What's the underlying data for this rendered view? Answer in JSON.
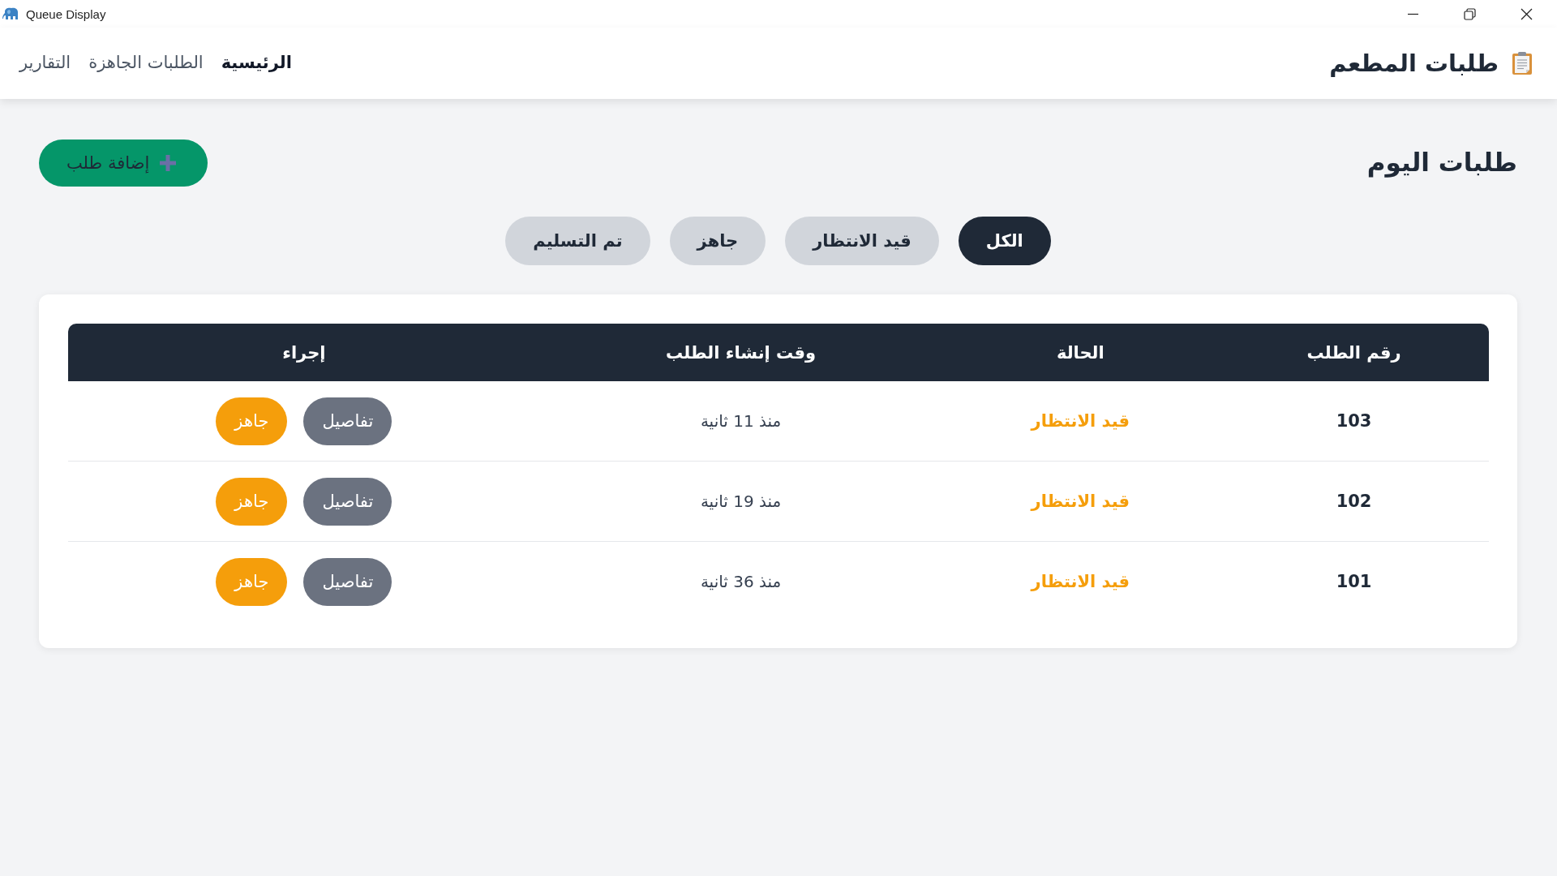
{
  "window": {
    "title": "Queue Display"
  },
  "navbar": {
    "brand": "طلبات المطعم",
    "links": [
      {
        "label": "الرئيسية",
        "selected": true
      },
      {
        "label": "الطلبات الجاهزة",
        "selected": false
      },
      {
        "label": "التقارير",
        "selected": false
      }
    ]
  },
  "toolbar": {
    "heading": "طلبات اليوم",
    "add_button": "إضافة طلب"
  },
  "filters": [
    {
      "label": "الكل",
      "selected": true
    },
    {
      "label": "قيد الانتظار",
      "selected": false
    },
    {
      "label": "جاهز",
      "selected": false
    },
    {
      "label": "تم التسليم",
      "selected": false
    }
  ],
  "table": {
    "columns": [
      "رقم الطلب",
      "الحالة",
      "وقت إنشاء الطلب",
      "إجراء"
    ],
    "rows": [
      {
        "order_number": "103",
        "status": {
          "label": "قيد الانتظار",
          "kind": "pending"
        },
        "created": "منذ 11 ثانية",
        "actions": [
          {
            "label": "تفاصيل",
            "kind": "details"
          },
          {
            "label": "جاهز",
            "kind": "ready"
          }
        ]
      },
      {
        "order_number": "102",
        "status": {
          "label": "قيد الانتظار",
          "kind": "pending"
        },
        "created": "منذ 19 ثانية",
        "actions": [
          {
            "label": "تفاصيل",
            "kind": "details"
          },
          {
            "label": "جاهز",
            "kind": "ready"
          }
        ]
      },
      {
        "order_number": "101",
        "status": {
          "label": "قيد الانتظار",
          "kind": "pending"
        },
        "created": "منذ 36 ثانية",
        "actions": [
          {
            "label": "تفاصيل",
            "kind": "details"
          },
          {
            "label": "جاهز",
            "kind": "ready"
          }
        ]
      }
    ]
  }
}
